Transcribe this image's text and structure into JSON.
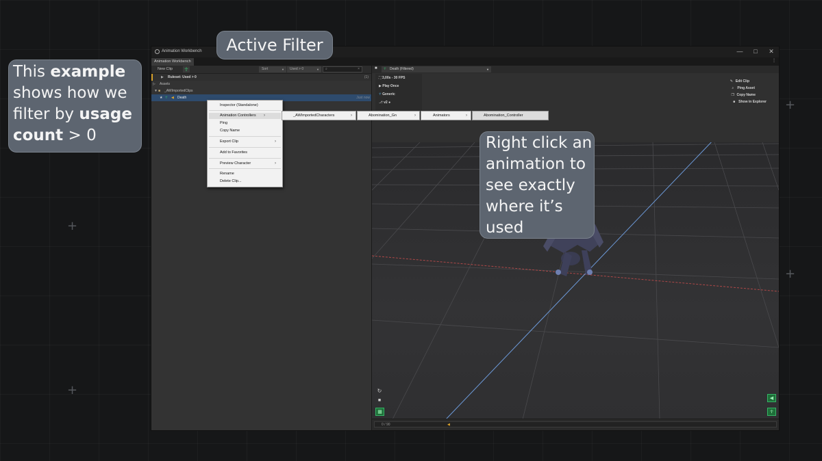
{
  "window": {
    "title": "Animation Workbench",
    "tab": "Animation Workbench",
    "controls": [
      "—",
      "□",
      "✕"
    ],
    "menu": "⋮"
  },
  "toolbar": {
    "new_clip": "New Clip",
    "sort_label": "Sort",
    "filter_value": "Used > 0",
    "search_value": "",
    "search_clear": "×"
  },
  "tree": {
    "ruleset": "Ruleset: Used > 0",
    "ruleset_count": "(1)",
    "assets": "Assets",
    "folder": "_AWImportedClips",
    "clip_name": "Death",
    "clip_time": "Just now"
  },
  "preview": {
    "clip_selector": "Death (Filtered)",
    "length": "3,00s - 30 FPS",
    "play_mode": "Play Once",
    "rig": "Generic",
    "version": "v2 ●",
    "tools": [
      "Edit Clip",
      "Ping Asset",
      "Copy Name",
      "Show in Explorer"
    ],
    "timeline": "0 / 90",
    "timeline_marker": "◀"
  },
  "context_menu": {
    "items": [
      "Inspector (Standalone)",
      "Animation Controllers",
      "Ping",
      "Copy Name",
      "Export Clip",
      "Add to Favorites",
      "Preview Character",
      "Rename",
      "Delete Clip..."
    ],
    "submenu_path": [
      "_AWImportedCharacters",
      "Abomination_Gn",
      "Animators",
      "Abomination_Controller"
    ]
  },
  "callouts": {
    "active_filter": "Active Filter",
    "example": {
      "t1": "This ",
      "t2": "example",
      "t3": "shows how we",
      "t4": "filter by ",
      "t5": "usage",
      "t6": "count",
      "t7": " > 0"
    },
    "right_click": [
      "Right click an",
      "animation to",
      "see exactly",
      "where it’s",
      "used"
    ]
  },
  "colors": {
    "accent_green": "#36b466",
    "bubble_bg": "#5d6570",
    "grid_red": "#b04848",
    "grid_blue": "#6d9ad9"
  }
}
